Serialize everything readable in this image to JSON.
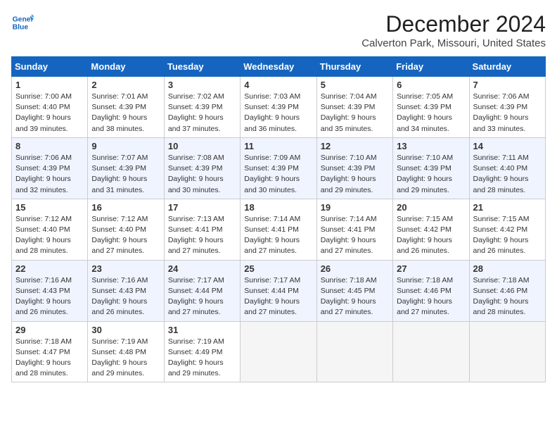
{
  "header": {
    "logo_line1": "General",
    "logo_line2": "Blue",
    "title": "December 2024",
    "subtitle": "Calverton Park, Missouri, United States"
  },
  "columns": [
    "Sunday",
    "Monday",
    "Tuesday",
    "Wednesday",
    "Thursday",
    "Friday",
    "Saturday"
  ],
  "weeks": [
    [
      {
        "day": "1",
        "sunrise": "Sunrise: 7:00 AM",
        "sunset": "Sunset: 4:40 PM",
        "daylight": "Daylight: 9 hours and 39 minutes."
      },
      {
        "day": "2",
        "sunrise": "Sunrise: 7:01 AM",
        "sunset": "Sunset: 4:39 PM",
        "daylight": "Daylight: 9 hours and 38 minutes."
      },
      {
        "day": "3",
        "sunrise": "Sunrise: 7:02 AM",
        "sunset": "Sunset: 4:39 PM",
        "daylight": "Daylight: 9 hours and 37 minutes."
      },
      {
        "day": "4",
        "sunrise": "Sunrise: 7:03 AM",
        "sunset": "Sunset: 4:39 PM",
        "daylight": "Daylight: 9 hours and 36 minutes."
      },
      {
        "day": "5",
        "sunrise": "Sunrise: 7:04 AM",
        "sunset": "Sunset: 4:39 PM",
        "daylight": "Daylight: 9 hours and 35 minutes."
      },
      {
        "day": "6",
        "sunrise": "Sunrise: 7:05 AM",
        "sunset": "Sunset: 4:39 PM",
        "daylight": "Daylight: 9 hours and 34 minutes."
      },
      {
        "day": "7",
        "sunrise": "Sunrise: 7:06 AM",
        "sunset": "Sunset: 4:39 PM",
        "daylight": "Daylight: 9 hours and 33 minutes."
      }
    ],
    [
      {
        "day": "8",
        "sunrise": "Sunrise: 7:06 AM",
        "sunset": "Sunset: 4:39 PM",
        "daylight": "Daylight: 9 hours and 32 minutes."
      },
      {
        "day": "9",
        "sunrise": "Sunrise: 7:07 AM",
        "sunset": "Sunset: 4:39 PM",
        "daylight": "Daylight: 9 hours and 31 minutes."
      },
      {
        "day": "10",
        "sunrise": "Sunrise: 7:08 AM",
        "sunset": "Sunset: 4:39 PM",
        "daylight": "Daylight: 9 hours and 30 minutes."
      },
      {
        "day": "11",
        "sunrise": "Sunrise: 7:09 AM",
        "sunset": "Sunset: 4:39 PM",
        "daylight": "Daylight: 9 hours and 30 minutes."
      },
      {
        "day": "12",
        "sunrise": "Sunrise: 7:10 AM",
        "sunset": "Sunset: 4:39 PM",
        "daylight": "Daylight: 9 hours and 29 minutes."
      },
      {
        "day": "13",
        "sunrise": "Sunrise: 7:10 AM",
        "sunset": "Sunset: 4:39 PM",
        "daylight": "Daylight: 9 hours and 29 minutes."
      },
      {
        "day": "14",
        "sunrise": "Sunrise: 7:11 AM",
        "sunset": "Sunset: 4:40 PM",
        "daylight": "Daylight: 9 hours and 28 minutes."
      }
    ],
    [
      {
        "day": "15",
        "sunrise": "Sunrise: 7:12 AM",
        "sunset": "Sunset: 4:40 PM",
        "daylight": "Daylight: 9 hours and 28 minutes."
      },
      {
        "day": "16",
        "sunrise": "Sunrise: 7:12 AM",
        "sunset": "Sunset: 4:40 PM",
        "daylight": "Daylight: 9 hours and 27 minutes."
      },
      {
        "day": "17",
        "sunrise": "Sunrise: 7:13 AM",
        "sunset": "Sunset: 4:41 PM",
        "daylight": "Daylight: 9 hours and 27 minutes."
      },
      {
        "day": "18",
        "sunrise": "Sunrise: 7:14 AM",
        "sunset": "Sunset: 4:41 PM",
        "daylight": "Daylight: 9 hours and 27 minutes."
      },
      {
        "day": "19",
        "sunrise": "Sunrise: 7:14 AM",
        "sunset": "Sunset: 4:41 PM",
        "daylight": "Daylight: 9 hours and 27 minutes."
      },
      {
        "day": "20",
        "sunrise": "Sunrise: 7:15 AM",
        "sunset": "Sunset: 4:42 PM",
        "daylight": "Daylight: 9 hours and 26 minutes."
      },
      {
        "day": "21",
        "sunrise": "Sunrise: 7:15 AM",
        "sunset": "Sunset: 4:42 PM",
        "daylight": "Daylight: 9 hours and 26 minutes."
      }
    ],
    [
      {
        "day": "22",
        "sunrise": "Sunrise: 7:16 AM",
        "sunset": "Sunset: 4:43 PM",
        "daylight": "Daylight: 9 hours and 26 minutes."
      },
      {
        "day": "23",
        "sunrise": "Sunrise: 7:16 AM",
        "sunset": "Sunset: 4:43 PM",
        "daylight": "Daylight: 9 hours and 26 minutes."
      },
      {
        "day": "24",
        "sunrise": "Sunrise: 7:17 AM",
        "sunset": "Sunset: 4:44 PM",
        "daylight": "Daylight: 9 hours and 27 minutes."
      },
      {
        "day": "25",
        "sunrise": "Sunrise: 7:17 AM",
        "sunset": "Sunset: 4:44 PM",
        "daylight": "Daylight: 9 hours and 27 minutes."
      },
      {
        "day": "26",
        "sunrise": "Sunrise: 7:18 AM",
        "sunset": "Sunset: 4:45 PM",
        "daylight": "Daylight: 9 hours and 27 minutes."
      },
      {
        "day": "27",
        "sunrise": "Sunrise: 7:18 AM",
        "sunset": "Sunset: 4:46 PM",
        "daylight": "Daylight: 9 hours and 27 minutes."
      },
      {
        "day": "28",
        "sunrise": "Sunrise: 7:18 AM",
        "sunset": "Sunset: 4:46 PM",
        "daylight": "Daylight: 9 hours and 28 minutes."
      }
    ],
    [
      {
        "day": "29",
        "sunrise": "Sunrise: 7:18 AM",
        "sunset": "Sunset: 4:47 PM",
        "daylight": "Daylight: 9 hours and 28 minutes."
      },
      {
        "day": "30",
        "sunrise": "Sunrise: 7:19 AM",
        "sunset": "Sunset: 4:48 PM",
        "daylight": "Daylight: 9 hours and 29 minutes."
      },
      {
        "day": "31",
        "sunrise": "Sunrise: 7:19 AM",
        "sunset": "Sunset: 4:49 PM",
        "daylight": "Daylight: 9 hours and 29 minutes."
      },
      null,
      null,
      null,
      null
    ]
  ]
}
